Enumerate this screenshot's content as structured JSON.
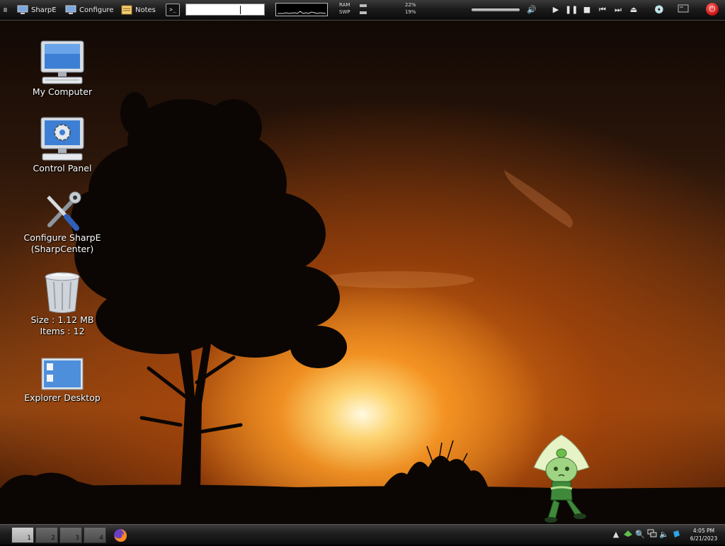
{
  "top_panel": {
    "launchers": [
      {
        "label": "SharpE",
        "icon": "monitor-icon"
      },
      {
        "label": "Configure",
        "icon": "monitor-icon"
      },
      {
        "label": "Notes",
        "icon": "notes-icon"
      }
    ],
    "terminal_label": ">_",
    "memory": {
      "ram_label": "RAM",
      "ram_value": "22%",
      "swap_label": "SWP",
      "swap_value": "19%"
    },
    "media_controls": [
      "volume-icon",
      "play-icon",
      "pause-icon",
      "stop-icon",
      "previous-icon",
      "next-icon",
      "eject-icon"
    ],
    "extra_icons": [
      "disc-icon",
      "screen-icon",
      "power-icon"
    ]
  },
  "desktop": {
    "icons": [
      {
        "label": "My Computer",
        "icon": "computer-icon"
      },
      {
        "label": "Control Panel",
        "icon": "control-panel-icon"
      },
      {
        "label_line1": "Configure SharpE",
        "label_line2": "(SharpCenter)",
        "icon": "tools-icon"
      },
      {
        "label_line1": "Size : 1.12 MB",
        "label_line2": "Items : 12",
        "icon": "recycle-bin-icon"
      },
      {
        "label": "Explorer Desktop",
        "icon": "explorer-desktop-icon"
      }
    ]
  },
  "bottom_panel": {
    "workspaces": [
      "1",
      "2",
      "3",
      "4"
    ],
    "active_workspace": "1",
    "tasks": [
      {
        "name": "Firefox",
        "icon": "firefox-icon"
      }
    ],
    "tray_icons": [
      "arrow-up-icon",
      "network-icon",
      "search-icon",
      "network-monitor-icon",
      "speaker-icon",
      "dropbox-icon"
    ],
    "clock": {
      "time": "4:05 PM",
      "date": "6/21/2023"
    }
  }
}
